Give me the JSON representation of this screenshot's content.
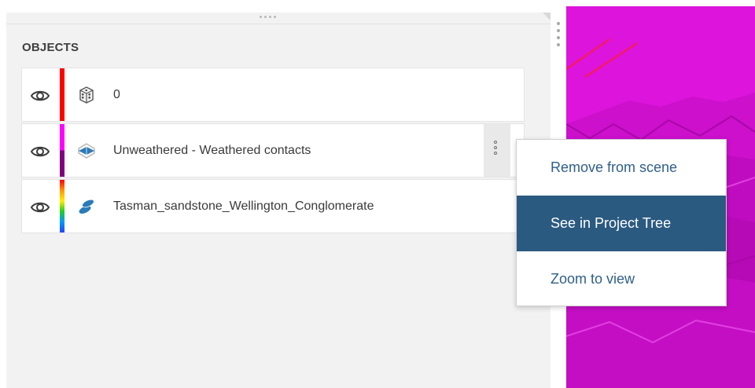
{
  "panel": {
    "section_title": "OBJECTS"
  },
  "objects": [
    {
      "label": "0",
      "icon": "block-model-icon",
      "visible": true,
      "color": "#ff0000"
    },
    {
      "label": "Unweathered - Weathered contacts",
      "icon": "surface-icon",
      "visible": true,
      "color_top": "#ff00ff",
      "color_bottom": "#800080"
    },
    {
      "label": "Tasman_sandstone_Wellington_Conglomerate",
      "icon": "geology-model-icon",
      "visible": true,
      "color": "rainbow"
    }
  ],
  "context_menu": {
    "items": [
      {
        "label": "Remove from scene",
        "active": false
      },
      {
        "label": "See in Project Tree",
        "active": true
      },
      {
        "label": "Zoom to view",
        "active": false
      }
    ]
  },
  "colors": {
    "viewport_bg": "#dc14dc",
    "menu_text": "#2f5f87",
    "menu_active_bg": "#2b5a80",
    "icon_blue": "#2b7ab8"
  }
}
